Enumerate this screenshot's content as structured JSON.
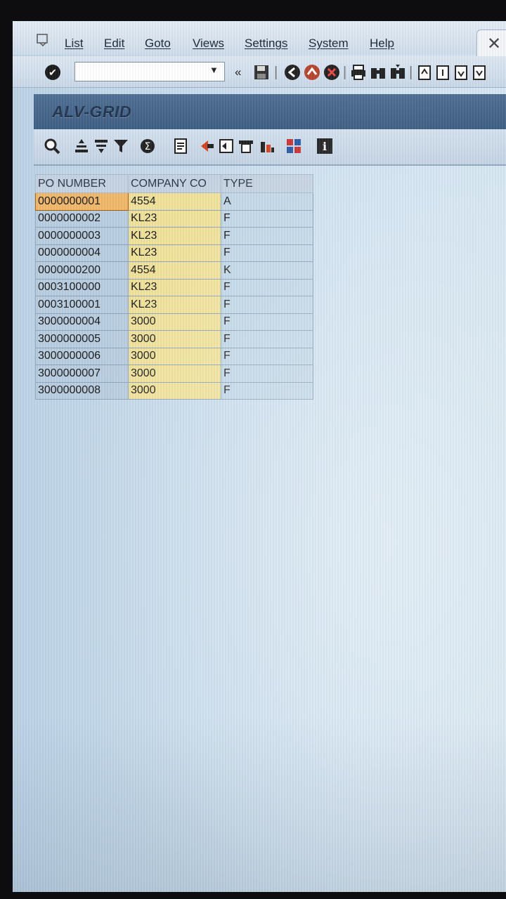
{
  "menu": {
    "items": [
      "List",
      "Edit",
      "Goto",
      "Views",
      "Settings",
      "System",
      "Help"
    ]
  },
  "toolbar": {
    "command_value": "",
    "back_label": "«"
  },
  "page": {
    "title": "ALV-GRID"
  },
  "app_toolbar": {
    "icons": [
      "details-icon",
      "sort-ascending-icon",
      "sort-descending-icon",
      "filter-icon",
      "total-icon",
      "print-preview-icon",
      "export-icon",
      "view-icon",
      "print-icon",
      "graphic-icon",
      "layout-icon",
      "information-icon"
    ]
  },
  "grid": {
    "columns": [
      "PO NUMBER",
      "COMPANY CO",
      "TYPE"
    ],
    "rows": [
      [
        "0000000001",
        "4554",
        "A"
      ],
      [
        "0000000002",
        "KL23",
        "F"
      ],
      [
        "0000000003",
        "KL23",
        "F"
      ],
      [
        "0000000004",
        "KL23",
        "F"
      ],
      [
        "0000000200",
        "4554",
        "K"
      ],
      [
        "0003100000",
        "KL23",
        "F"
      ],
      [
        "0003100001",
        "KL23",
        "F"
      ],
      [
        "3000000004",
        "3000",
        "F"
      ],
      [
        "3000000005",
        "3000",
        "F"
      ],
      [
        "3000000006",
        "3000",
        "F"
      ],
      [
        "3000000007",
        "3000",
        "F"
      ],
      [
        "3000000008",
        "3000",
        "F"
      ]
    ],
    "selected_row": 0
  },
  "colors": {
    "header_bar": "#3c5d82",
    "key_column": "#b8cde0",
    "company_column": "#f0e29a",
    "selected_cell": "#f0b86a"
  }
}
